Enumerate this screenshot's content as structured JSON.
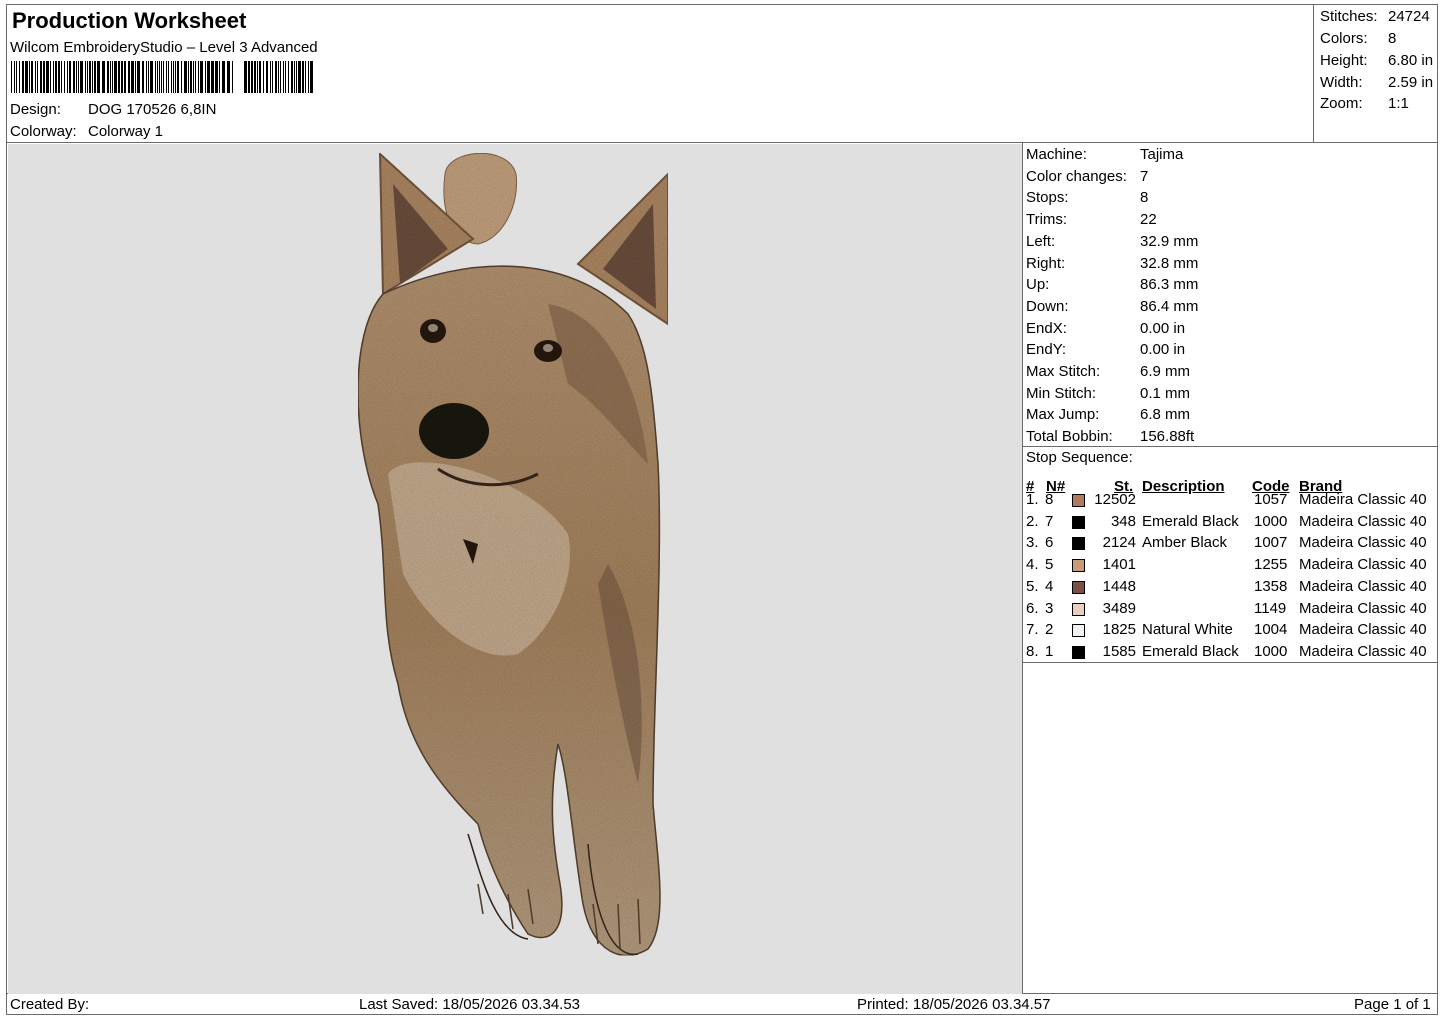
{
  "header": {
    "title": "Production Worksheet",
    "software": "Wilcom EmbroideryStudio – Level 3 Advanced",
    "design_label": "Design:",
    "design_value": "DOG 170526 6,8IN",
    "colorway_label": "Colorway:",
    "colorway_value": "Colorway 1"
  },
  "summary": [
    {
      "label": "Stitches:",
      "value": "24724"
    },
    {
      "label": "Colors:",
      "value": "8"
    },
    {
      "label": "Height:",
      "value": "6.80 in"
    },
    {
      "label": "Width:",
      "value": "2.59 in"
    },
    {
      "label": "Zoom:",
      "value": "1:1"
    }
  ],
  "machine_info": [
    {
      "label": "Machine:",
      "value": "Tajima"
    },
    {
      "label": "Color changes:",
      "value": "7"
    },
    {
      "label": "Stops:",
      "value": "8"
    },
    {
      "label": "Trims:",
      "value": "22"
    },
    {
      "label": "Left:",
      "value": "32.9 mm"
    },
    {
      "label": "Right:",
      "value": "32.8 mm"
    },
    {
      "label": "Up:",
      "value": "86.3 mm"
    },
    {
      "label": "Down:",
      "value": "86.4 mm"
    },
    {
      "label": "EndX:",
      "value": "0.00 in"
    },
    {
      "label": "EndY:",
      "value": "0.00 in"
    },
    {
      "label": "Max Stitch:",
      "value": "6.9 mm"
    },
    {
      "label": "Min Stitch:",
      "value": "0.1 mm"
    },
    {
      "label": "Max Jump:",
      "value": "6.8 mm"
    },
    {
      "label": "Total Bobbin:",
      "value": "156.88ft"
    }
  ],
  "stop_sequence": {
    "title": "Stop Sequence:",
    "headers": {
      "num": "#",
      "n": "N#",
      "st": "St.",
      "description": "Description",
      "code": "Code",
      "brand": "Brand"
    },
    "rows": [
      {
        "num": "1.",
        "n": "8",
        "color": "#b27b60",
        "st": "12502",
        "description": "",
        "code": "1057",
        "brand": "Madeira Classic 40"
      },
      {
        "num": "2.",
        "n": "7",
        "color": "#000000",
        "st": "348",
        "description": "Emerald Black",
        "code": "1000",
        "brand": "Madeira Classic 40"
      },
      {
        "num": "3.",
        "n": "6",
        "color": "#000000",
        "st": "2124",
        "description": "Amber Black",
        "code": "1007",
        "brand": "Madeira Classic 40"
      },
      {
        "num": "4.",
        "n": "5",
        "color": "#c89a78",
        "st": "1401",
        "description": "",
        "code": "1255",
        "brand": "Madeira Classic 40"
      },
      {
        "num": "5.",
        "n": "4",
        "color": "#7a4f44",
        "st": "1448",
        "description": "",
        "code": "1358",
        "brand": "Madeira Classic 40"
      },
      {
        "num": "6.",
        "n": "3",
        "color": "#e9cfbd",
        "st": "3489",
        "description": "",
        "code": "1149",
        "brand": "Madeira Classic 40"
      },
      {
        "num": "7.",
        "n": "2",
        "color": "#f2f2f2",
        "st": "1825",
        "description": "Natural White",
        "code": "1004",
        "brand": "Madeira Classic 40"
      },
      {
        "num": "8.",
        "n": "1",
        "color": "#000000",
        "st": "1585",
        "description": "Emerald Black",
        "code": "1000",
        "brand": "Madeira Classic 40"
      }
    ]
  },
  "footer": {
    "created_by": "Created By:",
    "last_saved": "Last Saved: 18/05/2026 03.34.53",
    "printed": "Printed: 18/05/2026 03.34.57",
    "page": "Page 1 of 1"
  }
}
